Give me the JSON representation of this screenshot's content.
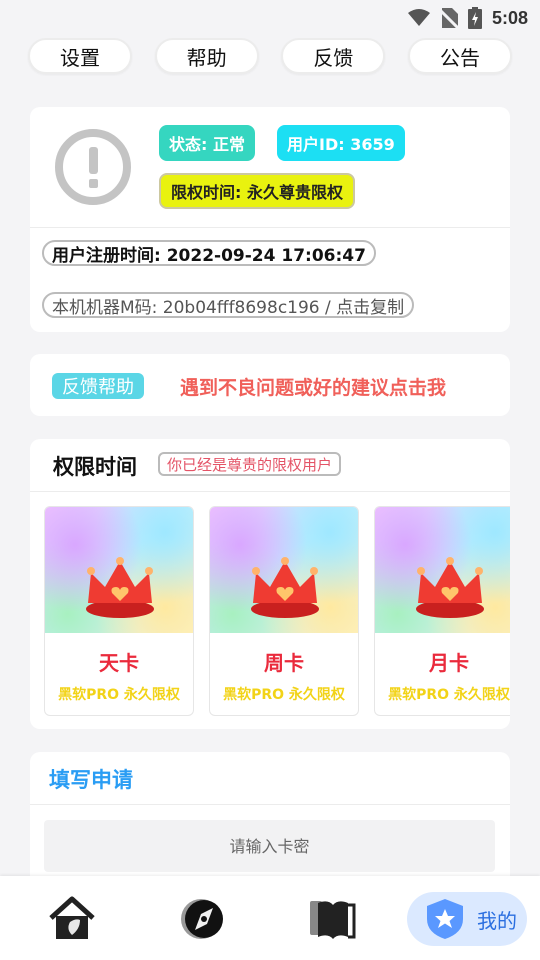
{
  "status_bar": {
    "time": "5:08"
  },
  "top_buttons": {
    "settings": "设置",
    "help": "帮助",
    "feedback": "反馈",
    "notice": "公告"
  },
  "profile": {
    "status_badge": "状态: 正常",
    "user_id_badge": "用户ID: 3659",
    "limit_badge": "限权时间: 永久尊贵限权",
    "register_time": "用户注册时间: 2022-09-24 17:06:47",
    "machine_code": "本机机器M码: 20b04fff8698c196 / 点击复制"
  },
  "help_bar": {
    "tag": "反馈帮助",
    "text": "遇到不良问题或好的建议点击我"
  },
  "permission": {
    "title": "权限时间",
    "subtitle": "你已经是尊贵的限权用户",
    "items": [
      {
        "name": "天卡",
        "desc": "黑软PRO 永久限权"
      },
      {
        "name": "周卡",
        "desc": "黑软PRO 永久限权"
      },
      {
        "name": "月卡",
        "desc": "黑软PRO 永久限权"
      }
    ]
  },
  "apply": {
    "title": "填写申请",
    "input_placeholder": "请输入卡密"
  },
  "tab_bar": {
    "mine_label": "我的"
  },
  "icons": [
    "wifi-icon",
    "no-sim-icon",
    "battery-icon",
    "alert-icon",
    "crown-icon",
    "home-icon",
    "compass-icon",
    "book-icon",
    "shield-star-icon"
  ],
  "colors": {
    "accent_blue": "#2a9df4",
    "status_teal": "#35d6c0",
    "uid_cyan": "#1cdff3",
    "limit_yellow": "#e9f20f",
    "help_red": "#f0605a",
    "card_red": "#ea2a3c",
    "card_yellow": "#f2d318"
  }
}
